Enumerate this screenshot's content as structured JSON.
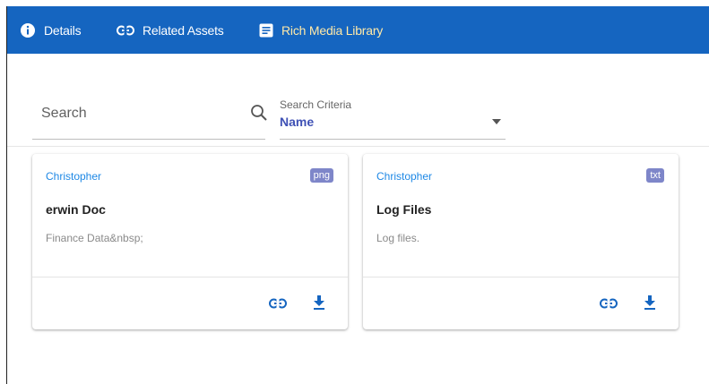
{
  "tabs": [
    {
      "label": "Details",
      "icon": "info-icon",
      "active": false
    },
    {
      "label": "Related Assets",
      "icon": "link-icon",
      "active": false
    },
    {
      "label": "Rich Media Library",
      "icon": "document-icon",
      "active": true
    }
  ],
  "search": {
    "placeholder": "Search",
    "value": ""
  },
  "criteria": {
    "label": "Search Criteria",
    "selected": "Name"
  },
  "cards": [
    {
      "owner": "Christopher",
      "type": "png",
      "title": "erwin Doc",
      "description": "Finance Data&nbsp;"
    },
    {
      "owner": "Christopher",
      "type": "txt",
      "title": "Log Files",
      "description": "Log files."
    }
  ],
  "colors": {
    "tabbar": "#1565c0",
    "active_tab_text": "#ffe9a8",
    "owner_link": "#1e88e5",
    "badge": "#7e86c9",
    "criteria_value": "#3f51b5"
  }
}
